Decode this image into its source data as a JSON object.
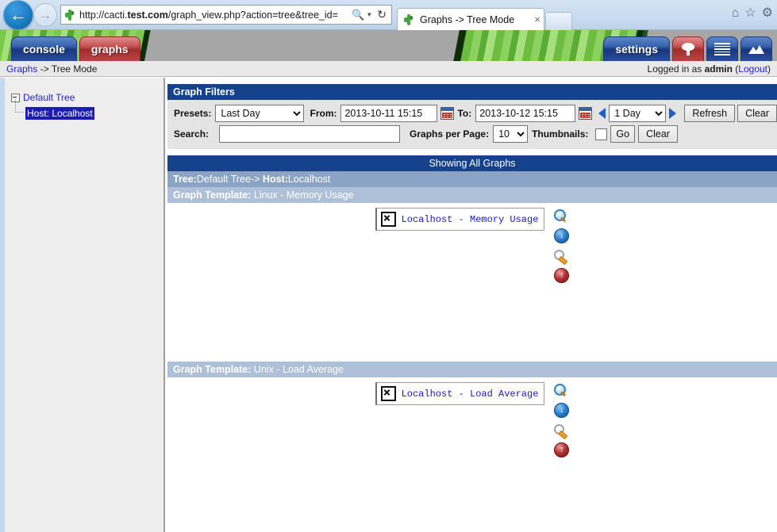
{
  "browser": {
    "url_prefix": "http://cacti.",
    "url_domain": "test.com",
    "url_suffix": "/graph_view.php?action=tree&tree_id=",
    "search_icon": "search-icon",
    "dropdown_icon": "chevron-down-icon",
    "reload_icon": "reload-icon",
    "back_icon": "back-arrow-icon",
    "forward_icon": "forward-arrow-icon",
    "tab_title": "Graphs -> Tree Mode",
    "tab_close": "×",
    "home_icon": "home-icon",
    "favorites_icon": "star-icon",
    "tools_icon": "gear-icon"
  },
  "nav": {
    "left_tabs": [
      {
        "label": "console",
        "style": "blue",
        "name": "nav-tab-console"
      },
      {
        "label": "graphs",
        "style": "red",
        "name": "nav-tab-graphs"
      }
    ],
    "right_tabs": [
      {
        "label": "settings",
        "style": "blue",
        "icon": "",
        "name": "nav-tab-settings"
      },
      {
        "label": "",
        "style": "red",
        "icon": "tree-icon",
        "name": "nav-tab-tree"
      },
      {
        "label": "",
        "style": "blue",
        "icon": "list-icon",
        "name": "nav-tab-list"
      },
      {
        "label": "",
        "style": "blue",
        "icon": "graph-preview-icon",
        "name": "nav-tab-preview"
      }
    ]
  },
  "breadcrumb": {
    "link": "Graphs",
    "separator": " -> ",
    "current": "Tree Mode"
  },
  "session": {
    "prefix": "Logged in as ",
    "user": "admin",
    "open_paren": " (",
    "logout": "Logout",
    "close_paren": ")"
  },
  "sidebar": {
    "root_label": "Default Tree",
    "child_label": "Host: Localhost"
  },
  "filters": {
    "title": "Graph Filters",
    "presets_label": "Presets:",
    "presets_value": "Last Day",
    "presets_options": [
      "Last Day"
    ],
    "from_label": "From:",
    "from_value": "2013-10-11 15:15",
    "to_label": "To:",
    "to_value": "2013-10-12 15:15",
    "calendar_icon": "calendar-icon",
    "prev_icon": "left-arrow-icon",
    "next_icon": "right-arrow-icon",
    "span_value": "1 Day",
    "span_options": [
      "1 Day"
    ],
    "refresh_label": "Refresh",
    "clear_label": "Clear",
    "search_label": "Search:",
    "search_value": "",
    "search_placeholder": "",
    "per_page_label": "Graphs per Page:",
    "per_page_value": "10",
    "per_page_options": [
      "10"
    ],
    "thumbnails_label": "Thumbnails:",
    "thumbnails_checked": false,
    "go_label": "Go",
    "clear2_label": "Clear"
  },
  "results": {
    "showing_label": "Showing All Graphs",
    "tree_prefix": "Tree:",
    "tree_name": "Default Tree-> ",
    "host_prefix": "Host:",
    "host_name": "Localhost",
    "sections": [
      {
        "template_label": "Graph Template:",
        "template_name": "Linux - Memory Usage",
        "graph_title": "Localhost - Memory Usage",
        "image_alt": "broken-image-icon",
        "actions": [
          {
            "name": "graph-zoom-icon",
            "kind": "zoom"
          },
          {
            "name": "graph-csv-export-icon",
            "kind": "download"
          },
          {
            "name": "graph-properties-icon",
            "kind": "wrench"
          },
          {
            "name": "graph-page-top-icon",
            "kind": "up"
          }
        ]
      },
      {
        "template_label": "Graph Template:",
        "template_name": "Unix - Load Average",
        "graph_title": "Localhost - Load Average",
        "image_alt": "broken-image-icon",
        "actions": [
          {
            "name": "graph-zoom-icon",
            "kind": "zoom"
          },
          {
            "name": "graph-csv-export-icon",
            "kind": "download"
          },
          {
            "name": "graph-properties-icon",
            "kind": "wrench"
          },
          {
            "name": "graph-page-top-icon",
            "kind": "up"
          }
        ]
      }
    ]
  },
  "colors": {
    "header_blue": "#16418c",
    "tree_bar": "#8ba3c4",
    "template_bar": "#adc0d8",
    "link_blue": "#2222cc",
    "selection_blue": "#1c1cb4",
    "banner_grey": "#a6a6a6",
    "cacti_green": "#79c94a"
  }
}
